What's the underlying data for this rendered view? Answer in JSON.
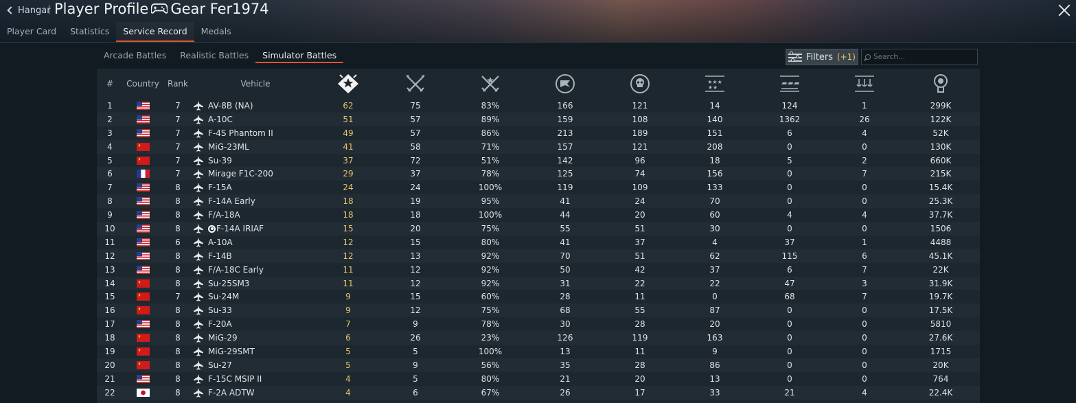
{
  "header": {
    "back_label": "Hangar",
    "title_left": "Player Profile",
    "title_right": "Gear Fer1974",
    "gamepad_icon": "gamepad-icon",
    "close_icon": "close-icon"
  },
  "tabs": [
    {
      "label": "Player Card",
      "active": false
    },
    {
      "label": "Statistics",
      "active": false
    },
    {
      "label": "Service Record",
      "active": true
    },
    {
      "label": "Medals",
      "active": false
    }
  ],
  "subtabs": [
    {
      "label": "Arcade Battles",
      "active": false
    },
    {
      "label": "Realistic Battles",
      "active": false
    },
    {
      "label": "Simulator Battles",
      "active": true
    }
  ],
  "filters": {
    "label": "Filters",
    "count": "(+1)"
  },
  "search": {
    "placeholder": "Search...",
    "value": ""
  },
  "columns": {
    "num": "#",
    "country": "Country",
    "rank": "Rank",
    "vehicle": "Vehicle",
    "icons": [
      "victories-icon",
      "battles-icon",
      "win-rate-icon",
      "deaths-icon",
      "air-targets-destroyed-icon",
      "air-kills-icon",
      "ground-targets-destroyed-icon",
      "naval-targets-destroyed-icon",
      "experience-icon"
    ]
  },
  "rows": [
    {
      "n": "1",
      "country": "usa",
      "rank": "7",
      "vehicle": "AV-8B (NA)",
      "marked": false,
      "c1": "62",
      "c2": "75",
      "c3": "83%",
      "c4": "166",
      "c5": "121",
      "c6": "14",
      "c7": "124",
      "c8": "1",
      "c9": "299K"
    },
    {
      "n": "2",
      "country": "usa",
      "rank": "7",
      "vehicle": "A-10C",
      "marked": false,
      "c1": "51",
      "c2": "57",
      "c3": "89%",
      "c4": "159",
      "c5": "108",
      "c6": "140",
      "c7": "1362",
      "c8": "26",
      "c9": "122K"
    },
    {
      "n": "3",
      "country": "usa",
      "rank": "7",
      "vehicle": "F-4S Phantom II",
      "marked": false,
      "c1": "49",
      "c2": "57",
      "c3": "86%",
      "c4": "213",
      "c5": "189",
      "c6": "151",
      "c7": "6",
      "c8": "4",
      "c9": "52K"
    },
    {
      "n": "4",
      "country": "ussr",
      "rank": "7",
      "vehicle": "MiG-23ML",
      "marked": false,
      "c1": "41",
      "c2": "58",
      "c3": "71%",
      "c4": "157",
      "c5": "121",
      "c6": "208",
      "c7": "0",
      "c8": "0",
      "c9": "130K"
    },
    {
      "n": "5",
      "country": "ussr",
      "rank": "7",
      "vehicle": "Su-39",
      "marked": false,
      "c1": "37",
      "c2": "72",
      "c3": "51%",
      "c4": "142",
      "c5": "96",
      "c6": "18",
      "c7": "5",
      "c8": "2",
      "c9": "660K"
    },
    {
      "n": "6",
      "country": "france",
      "rank": "7",
      "vehicle": "Mirage F1C-200",
      "marked": false,
      "c1": "29",
      "c2": "37",
      "c3": "78%",
      "c4": "125",
      "c5": "74",
      "c6": "156",
      "c7": "0",
      "c8": "7",
      "c9": "215K"
    },
    {
      "n": "7",
      "country": "usa",
      "rank": "8",
      "vehicle": "F-15A",
      "marked": false,
      "c1": "24",
      "c2": "24",
      "c3": "100%",
      "c4": "119",
      "c5": "109",
      "c6": "133",
      "c7": "0",
      "c8": "0",
      "c9": "15.4K"
    },
    {
      "n": "8",
      "country": "usa",
      "rank": "8",
      "vehicle": "F-14A Early",
      "marked": false,
      "c1": "18",
      "c2": "19",
      "c3": "95%",
      "c4": "41",
      "c5": "24",
      "c6": "70",
      "c7": "0",
      "c8": "0",
      "c9": "25.3K"
    },
    {
      "n": "9",
      "country": "usa",
      "rank": "8",
      "vehicle": "F/A-18A",
      "marked": false,
      "c1": "18",
      "c2": "18",
      "c3": "100%",
      "c4": "44",
      "c5": "20",
      "c6": "60",
      "c7": "4",
      "c8": "4",
      "c9": "37.7K"
    },
    {
      "n": "10",
      "country": "usa",
      "rank": "8",
      "vehicle": "F-14A IRIAF",
      "marked": true,
      "c1": "15",
      "c2": "20",
      "c3": "75%",
      "c4": "55",
      "c5": "51",
      "c6": "30",
      "c7": "0",
      "c8": "0",
      "c9": "1506"
    },
    {
      "n": "11",
      "country": "usa",
      "rank": "6",
      "vehicle": "A-10A",
      "marked": false,
      "c1": "12",
      "c2": "15",
      "c3": "80%",
      "c4": "41",
      "c5": "37",
      "c6": "4",
      "c7": "37",
      "c8": "1",
      "c9": "4488"
    },
    {
      "n": "12",
      "country": "usa",
      "rank": "8",
      "vehicle": "F-14B",
      "marked": false,
      "c1": "12",
      "c2": "13",
      "c3": "92%",
      "c4": "70",
      "c5": "51",
      "c6": "62",
      "c7": "115",
      "c8": "6",
      "c9": "45.1K"
    },
    {
      "n": "13",
      "country": "usa",
      "rank": "8",
      "vehicle": "F/A-18C Early",
      "marked": false,
      "c1": "11",
      "c2": "12",
      "c3": "92%",
      "c4": "50",
      "c5": "42",
      "c6": "37",
      "c7": "6",
      "c8": "7",
      "c9": "22K"
    },
    {
      "n": "14",
      "country": "ussr",
      "rank": "8",
      "vehicle": "Su-25SM3",
      "marked": false,
      "c1": "11",
      "c2": "12",
      "c3": "92%",
      "c4": "31",
      "c5": "22",
      "c6": "22",
      "c7": "47",
      "c8": "3",
      "c9": "31.9K"
    },
    {
      "n": "15",
      "country": "ussr",
      "rank": "7",
      "vehicle": "Su-24M",
      "marked": false,
      "c1": "9",
      "c2": "15",
      "c3": "60%",
      "c4": "28",
      "c5": "11",
      "c6": "0",
      "c7": "68",
      "c8": "7",
      "c9": "19.7K"
    },
    {
      "n": "16",
      "country": "ussr",
      "rank": "8",
      "vehicle": "Su-33",
      "marked": false,
      "c1": "9",
      "c2": "12",
      "c3": "75%",
      "c4": "68",
      "c5": "55",
      "c6": "87",
      "c7": "0",
      "c8": "0",
      "c9": "17.5K"
    },
    {
      "n": "17",
      "country": "usa",
      "rank": "8",
      "vehicle": "F-20A",
      "marked": false,
      "c1": "7",
      "c2": "9",
      "c3": "78%",
      "c4": "30",
      "c5": "28",
      "c6": "20",
      "c7": "0",
      "c8": "0",
      "c9": "5810"
    },
    {
      "n": "18",
      "country": "ussr",
      "rank": "8",
      "vehicle": "MiG-29",
      "marked": false,
      "c1": "6",
      "c2": "26",
      "c3": "23%",
      "c4": "126",
      "c5": "119",
      "c6": "163",
      "c7": "0",
      "c8": "0",
      "c9": "27.6K"
    },
    {
      "n": "19",
      "country": "ussr",
      "rank": "8",
      "vehicle": "MiG-29SMT",
      "marked": false,
      "c1": "5",
      "c2": "5",
      "c3": "100%",
      "c4": "13",
      "c5": "11",
      "c6": "9",
      "c7": "0",
      "c8": "0",
      "c9": "1715"
    },
    {
      "n": "20",
      "country": "ussr",
      "rank": "8",
      "vehicle": "Su-27",
      "marked": false,
      "c1": "5",
      "c2": "9",
      "c3": "56%",
      "c4": "35",
      "c5": "28",
      "c6": "86",
      "c7": "0",
      "c8": "0",
      "c9": "20K"
    },
    {
      "n": "21",
      "country": "usa",
      "rank": "8",
      "vehicle": "F-15C MSIP II",
      "marked": false,
      "c1": "4",
      "c2": "5",
      "c3": "80%",
      "c4": "21",
      "c5": "20",
      "c6": "13",
      "c7": "0",
      "c8": "0",
      "c9": "764"
    },
    {
      "n": "22",
      "country": "japan",
      "rank": "8",
      "vehicle": "F-2A ADTW",
      "marked": false,
      "c1": "4",
      "c2": "6",
      "c3": "67%",
      "c4": "26",
      "c5": "17",
      "c6": "33",
      "c7": "21",
      "c8": "4",
      "c9": "22.4K"
    }
  ],
  "colors": {
    "accent": "#e0552e",
    "gold": "#e8c46a"
  }
}
